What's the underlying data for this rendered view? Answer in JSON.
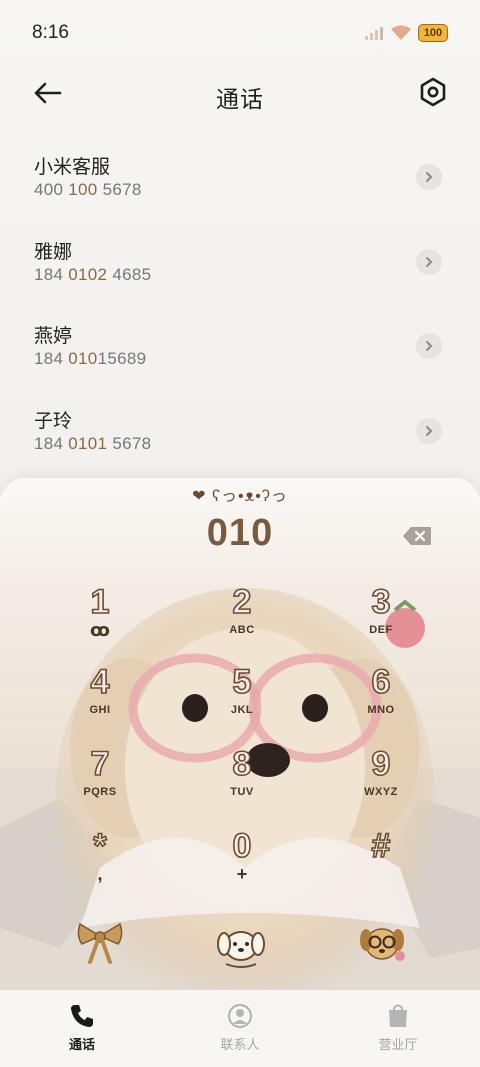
{
  "status": {
    "time": "8:16",
    "battery": "100",
    "icons": [
      "signal-icon",
      "wifi-icon",
      "battery-icon"
    ]
  },
  "header": {
    "title": "通话",
    "back_icon": "back-arrow-icon",
    "settings_icon": "settings-icon"
  },
  "results": [
    {
      "name": "小米客服",
      "number_pre": "400 ",
      "number_hl": "100",
      "number_post": " 5678"
    },
    {
      "name": "雅娜",
      "number_pre": "184 ",
      "number_hl": "0102",
      "number_post": " 4685"
    },
    {
      "name": "燕婷",
      "number_pre": "184 ",
      "number_hl": "010",
      "number_post": "15689"
    },
    {
      "name": "子玲",
      "number_pre": "184 ",
      "number_hl": "0101",
      "number_post": " 5678"
    }
  ],
  "dialpad": {
    "kaomoji": "❤ ʕっ•ᴥ•ʔっ",
    "dialed": "010",
    "keys": [
      {
        "digit": "1",
        "letters": "",
        "sub": "ꝏ"
      },
      {
        "digit": "2",
        "letters": "ABC",
        "sub": ""
      },
      {
        "digit": "3",
        "letters": "DEF",
        "sub": ""
      },
      {
        "digit": "4",
        "letters": "GHI",
        "sub": ""
      },
      {
        "digit": "5",
        "letters": "JKL",
        "sub": ""
      },
      {
        "digit": "6",
        "letters": "MNO",
        "sub": ""
      },
      {
        "digit": "7",
        "letters": "PQRS",
        "sub": ""
      },
      {
        "digit": "8",
        "letters": "TUV",
        "sub": ""
      },
      {
        "digit": "9",
        "letters": "WXYZ",
        "sub": ""
      },
      {
        "digit": "*",
        "letters": "",
        "sub": ","
      },
      {
        "digit": "0",
        "letters": "",
        "sub": "+"
      },
      {
        "digit": "#",
        "letters": "",
        "sub": ""
      }
    ],
    "actions": [
      "bow-icon",
      "puppy-call-icon",
      "puppy-glasses-icon"
    ]
  },
  "nav": {
    "items": [
      {
        "label": "通话",
        "icon": "phone-icon",
        "active": true
      },
      {
        "label": "联系人",
        "icon": "contact-icon",
        "active": false
      },
      {
        "label": "营业厅",
        "icon": "shop-bag-icon",
        "active": false
      }
    ]
  },
  "colors": {
    "accent_brown": "#7a5a3e",
    "highlight": "#8a6a45",
    "battery": "#f0b436"
  }
}
